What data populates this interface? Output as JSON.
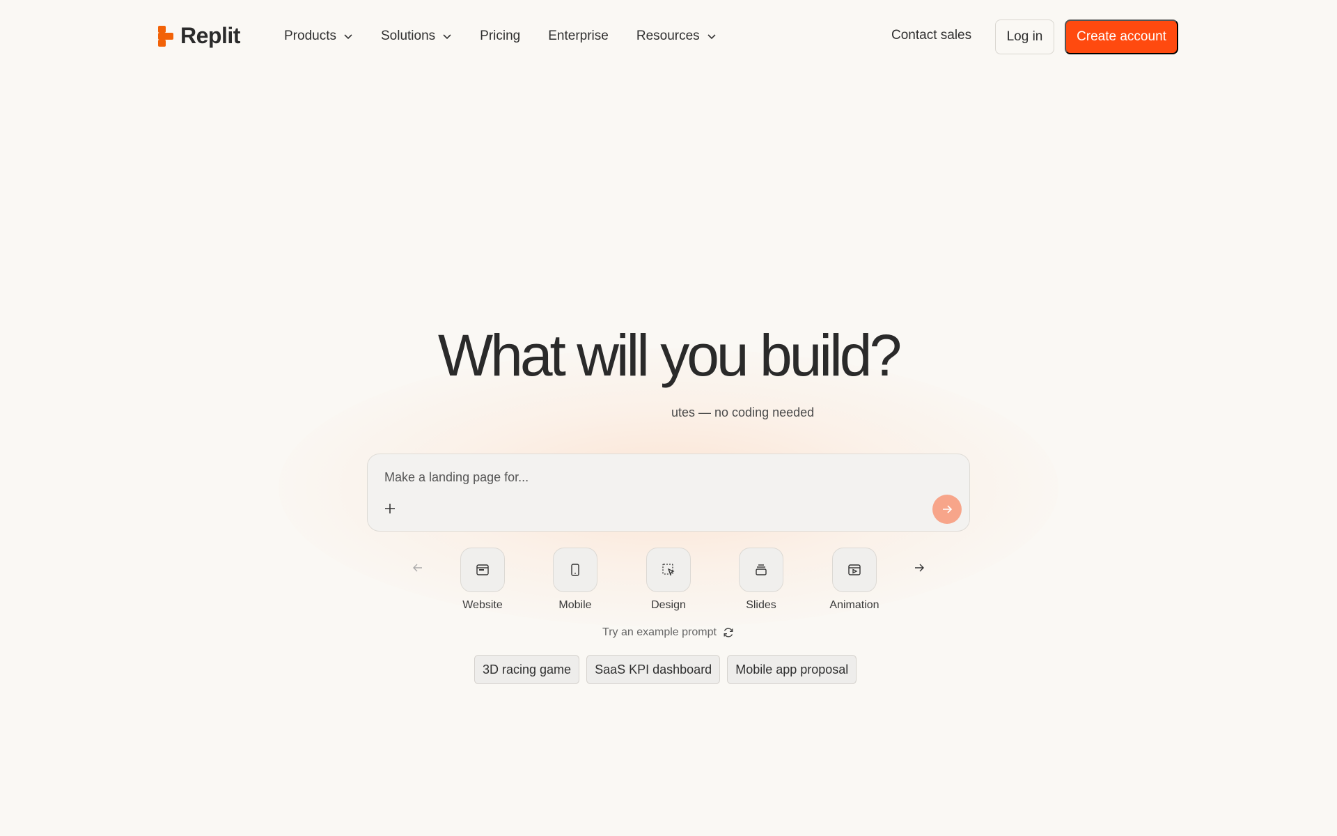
{
  "brand": {
    "name": "Replit",
    "color": "#f26207"
  },
  "nav": {
    "items": [
      {
        "label": "Products",
        "dropdown": true
      },
      {
        "label": "Solutions",
        "dropdown": true
      },
      {
        "label": "Pricing",
        "dropdown": false
      },
      {
        "label": "Enterprise",
        "dropdown": false
      },
      {
        "label": "Resources",
        "dropdown": true
      }
    ],
    "contact_label": "Contact sales",
    "login_label": "Log in",
    "create_label": "Create account",
    "accent": "#ff4a0f"
  },
  "hero": {
    "title": "What will you build?",
    "subtitle": "utes — no coding needed"
  },
  "prompt": {
    "placeholder": "Make a landing page for...",
    "value": "",
    "attach_icon": "plus-icon",
    "send_icon": "arrow-right-icon"
  },
  "types": [
    {
      "label": "Website",
      "icon": "browser-window-icon"
    },
    {
      "label": "Mobile",
      "icon": "mobile-phone-icon"
    },
    {
      "label": "Design",
      "icon": "design-select-cursor-icon"
    },
    {
      "label": "Slides",
      "icon": "slides-stack-icon"
    },
    {
      "label": "Animation",
      "icon": "animation-play-icon"
    }
  ],
  "examples": {
    "label": "Try an example prompt",
    "icon": "refresh-icon",
    "chips": [
      "3D racing game",
      "SaaS KPI dashboard",
      "Mobile app proposal"
    ]
  }
}
